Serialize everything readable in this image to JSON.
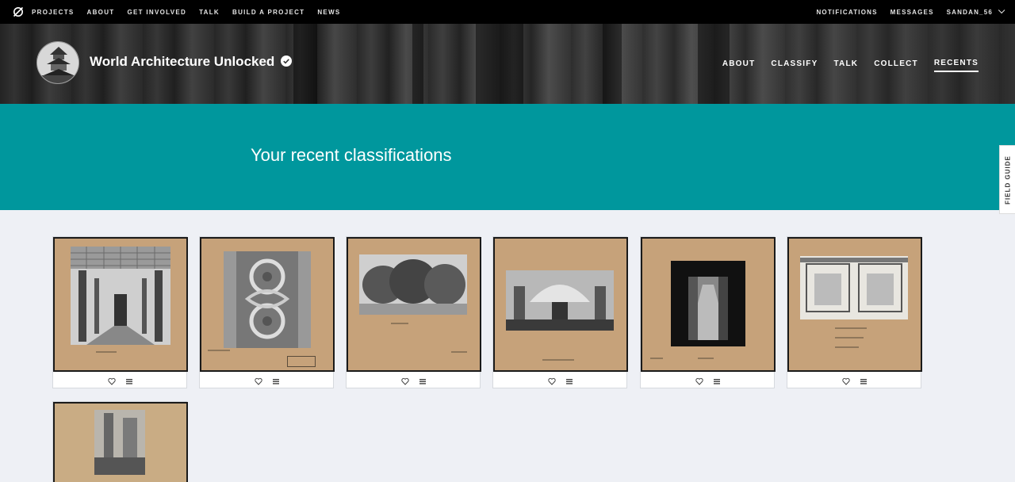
{
  "topnav": {
    "items": [
      "PROJECTS",
      "ABOUT",
      "GET INVOLVED",
      "TALK",
      "BUILD A PROJECT",
      "NEWS"
    ],
    "right": [
      "NOTIFICATIONS",
      "MESSAGES",
      "SANDAN_56"
    ]
  },
  "project": {
    "title": "World Architecture Unlocked",
    "nav": [
      "ABOUT",
      "CLASSIFY",
      "TALK",
      "COLLECT",
      "RECENTS"
    ]
  },
  "banner": {
    "heading": "Your recent classifications"
  },
  "field_guide": "FIELD GUIDE",
  "icons": {
    "logo": "zooniverse-logo-icon",
    "verified": "verified-check-icon",
    "favorite": "heart-icon",
    "collect": "list-icon"
  },
  "colors": {
    "topbar": "#000000",
    "banner": "#00979d",
    "background": "#eef0f5",
    "paper": "#c6a27a"
  },
  "recents": [
    {
      "subject": "church-nave-interior"
    },
    {
      "subject": "carved-stone-panel"
    },
    {
      "subject": "trees-landscape"
    },
    {
      "subject": "domed-church-interior"
    },
    {
      "subject": "narrow-alley"
    },
    {
      "subject": "window-drawings"
    },
    {
      "subject": "tower-street-scene"
    }
  ]
}
